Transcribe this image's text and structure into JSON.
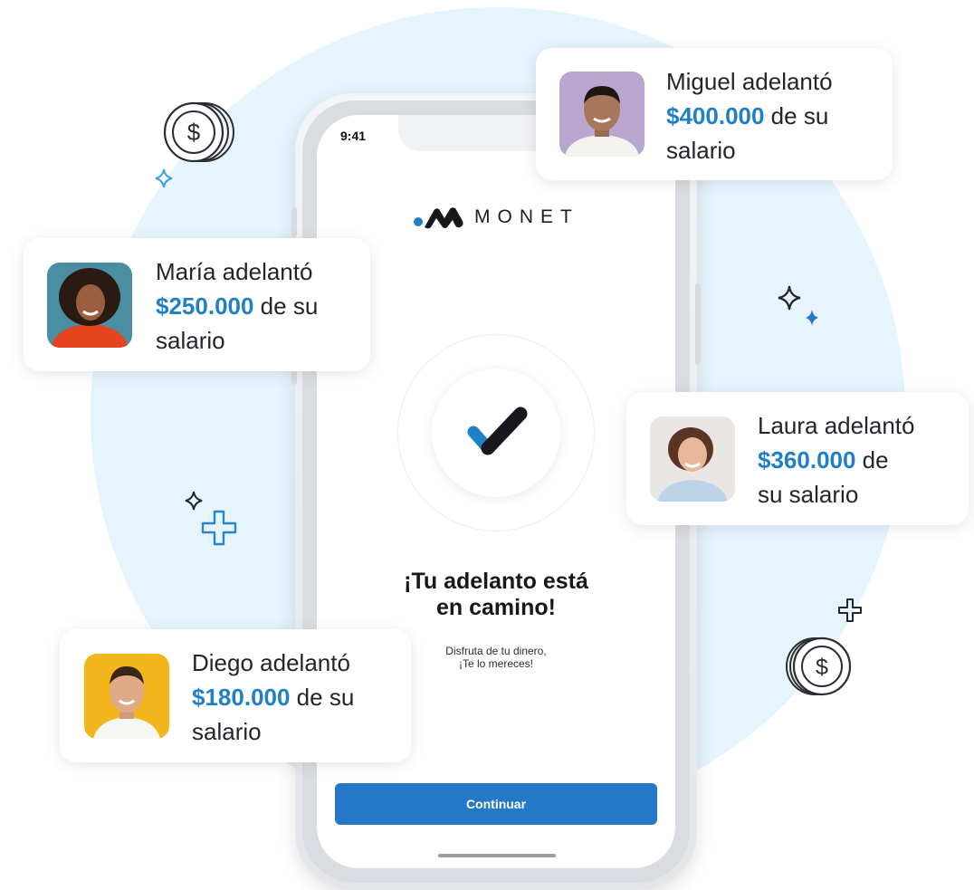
{
  "phone": {
    "status_time": "9:41",
    "brand": "MONET",
    "headline_line1": "¡Tu adelanto está",
    "headline_line2": "en camino!",
    "subtext_line1": "Disfruta de tu dinero,",
    "subtext_line2": "¡Te lo mereces!",
    "continue_label": "Continuar"
  },
  "cards": {
    "miguel": {
      "name_line": "Miguel adelantó",
      "amount": "$400.000",
      "after_amount": " de su",
      "last_line": "salario"
    },
    "maria": {
      "name_line": "María adelantó",
      "amount": "$250.000",
      "after_amount": " de su",
      "last_line": "salario"
    },
    "laura": {
      "name_line": "Laura adelantó",
      "amount": "$360.000",
      "after_amount": " de",
      "last_line": "su salario"
    },
    "diego": {
      "name_line": "Diego adelantó",
      "amount": "$180.000",
      "after_amount": " de su",
      "last_line": "salario"
    }
  },
  "colors": {
    "accent_blue": "#1f80c6",
    "button_blue": "#2578c8",
    "background_circle": "#e6f4fd"
  },
  "icons": [
    "dollar-coin-icon",
    "sparkle-icon",
    "plus-icon",
    "check-icon"
  ]
}
